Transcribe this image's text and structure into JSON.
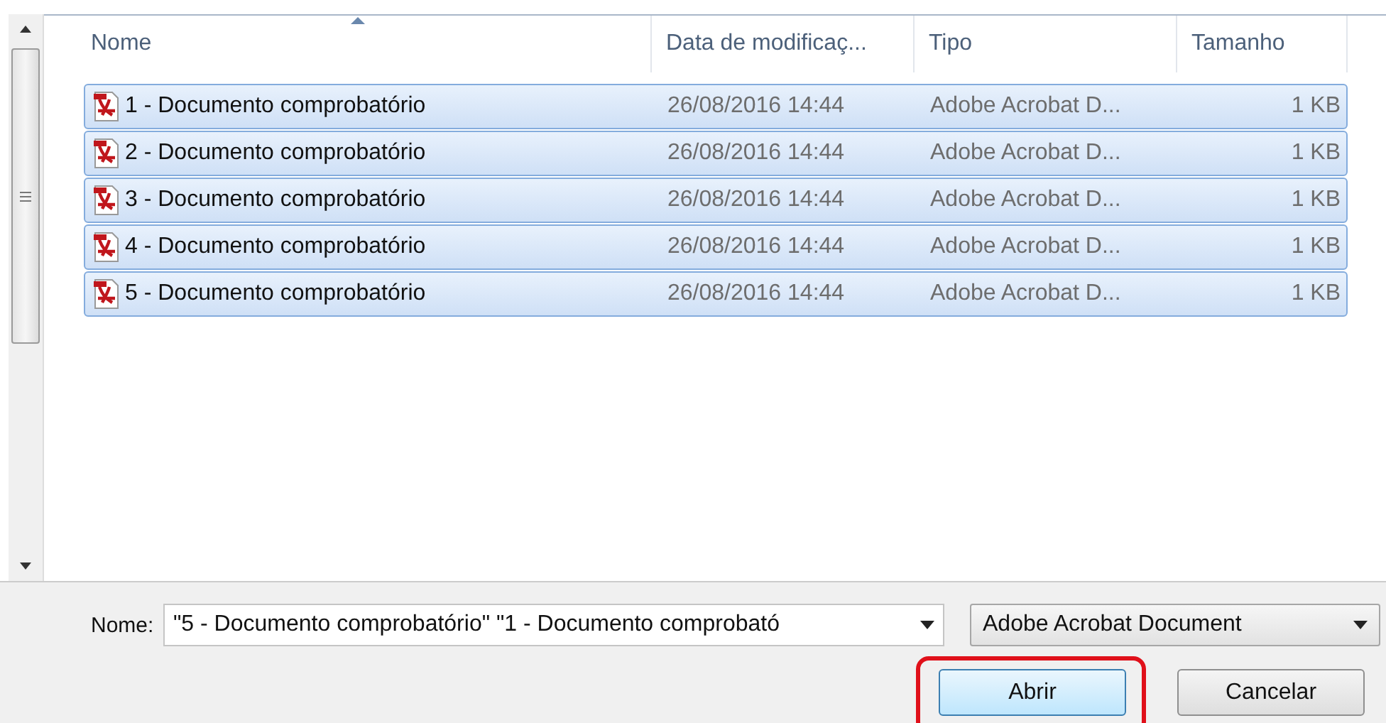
{
  "columns": [
    {
      "label": "Nome",
      "sorted": true
    },
    {
      "label": "Data de modificaç...",
      "sorted": false
    },
    {
      "label": "Tipo",
      "sorted": false
    },
    {
      "label": "Tamanho",
      "sorted": false
    }
  ],
  "rows": [
    {
      "name": "1 - Documento comprobatório",
      "date": "26/08/2016 14:44",
      "type": "Adobe Acrobat D...",
      "size": "1 KB",
      "selected": true
    },
    {
      "name": "2 - Documento comprobatório",
      "date": "26/08/2016 14:44",
      "type": "Adobe Acrobat D...",
      "size": "1 KB",
      "selected": true
    },
    {
      "name": "3 - Documento comprobatório",
      "date": "26/08/2016 14:44",
      "type": "Adobe Acrobat D...",
      "size": "1 KB",
      "selected": true
    },
    {
      "name": "4 - Documento comprobatório",
      "date": "26/08/2016 14:44",
      "type": "Adobe Acrobat D...",
      "size": "1 KB",
      "selected": true
    },
    {
      "name": "5 - Documento comprobatório",
      "date": "26/08/2016 14:44",
      "type": "Adobe Acrobat D...",
      "size": "1 KB",
      "selected": true
    }
  ],
  "filename": {
    "label": "Nome:",
    "value": "\"5 - Documento comprobatório\" \"1 - Documento comprobató"
  },
  "filetype": {
    "value": "Adobe Acrobat Document"
  },
  "buttons": [
    {
      "label": "Abrir",
      "highlighted": true
    },
    {
      "label": "Cancelar",
      "highlighted": false
    }
  ]
}
